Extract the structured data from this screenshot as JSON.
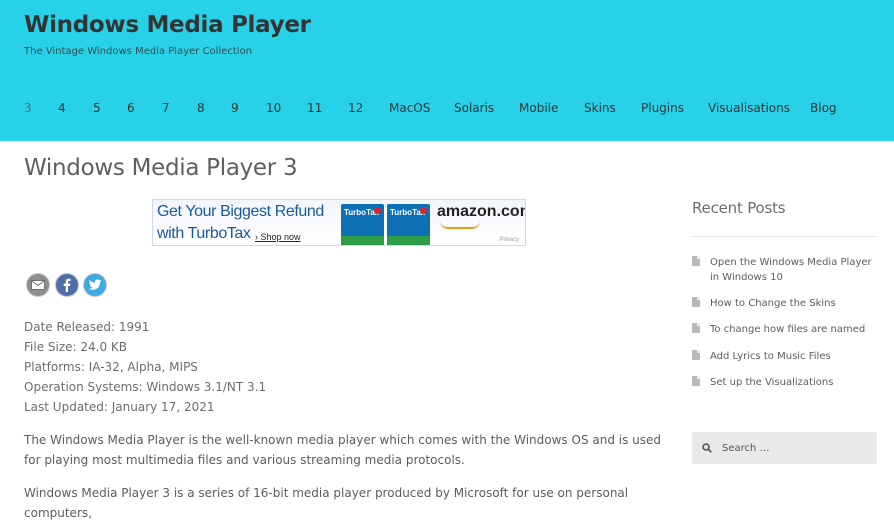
{
  "site": {
    "title": "Windows Media Player",
    "description": "The Vintage Windows Media Player Collection"
  },
  "nav": {
    "items": [
      "3",
      "4",
      "5",
      "6",
      "7",
      "8",
      "9",
      "10",
      "11",
      "12",
      "MacOS",
      "Solaris",
      "Mobile",
      "Skins",
      "Plugins",
      "Visualisations",
      "Blog"
    ],
    "active": "3"
  },
  "page": {
    "title": "Windows Media Player 3"
  },
  "ad": {
    "line1": "Get Your Biggest Refund",
    "line2": "with TurboTax",
    "shop_link": "› Shop now",
    "box1_label": "TurboTax",
    "box2_label": "TurboTax",
    "amazon": "amazon.com",
    "privacy": "Privacy"
  },
  "share": {
    "icons": [
      "email-icon",
      "facebook-icon",
      "twitter-icon"
    ]
  },
  "meta": {
    "date_released": "Date Released: 1991",
    "file_size": "File Size: 24.0 KB",
    "platforms": "Platforms: IA-32, Alpha, MIPS",
    "os": "Operation Systems: Windows 3.1/NT 3.1",
    "last_updated": "Last Updated: January 17, 2021"
  },
  "content": {
    "para1": "The Windows Media Player is the well-known media player which comes with the Windows OS and is used for playing most multimedia files and various streaming media protocols.",
    "para2": "Windows Media Player 3 is a series of 16-bit media player produced by Microsoft for use on personal computers,"
  },
  "sidebar": {
    "recent_title": "Recent Posts",
    "posts": [
      "Open the Windows Media Player in Windows 10",
      "How to Change the Skins",
      "To change how files are named",
      "Add Lyrics to Music Files",
      "Set up the Visualizations"
    ],
    "search_placeholder": "Search …"
  },
  "colors": {
    "header_bg": "#27d2e9",
    "title": "#333333",
    "sidebar_search_bg": "#e9e9e9"
  }
}
